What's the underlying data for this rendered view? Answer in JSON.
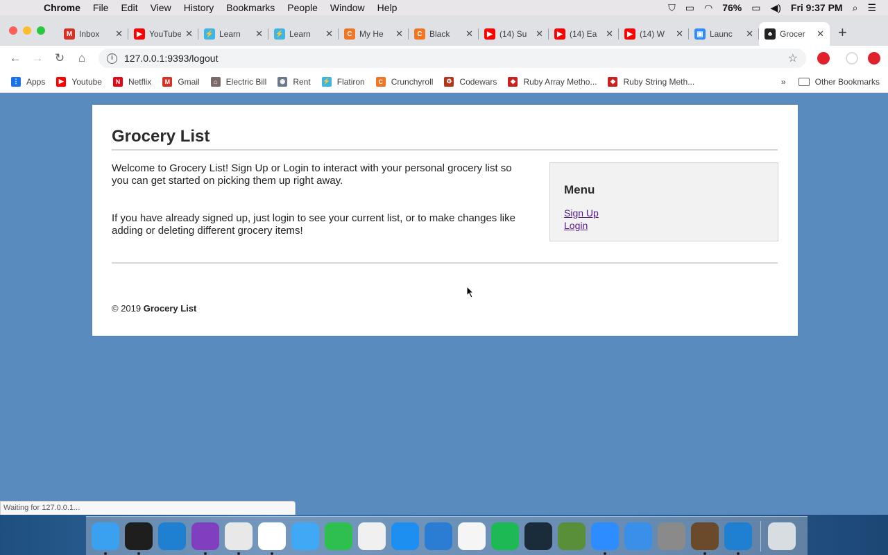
{
  "menubar": {
    "app": "Chrome",
    "items": [
      "File",
      "Edit",
      "View",
      "History",
      "Bookmarks",
      "People",
      "Window",
      "Help"
    ],
    "battery": "76%",
    "clock": "Fri 9:37 PM"
  },
  "tabs": [
    {
      "title": "Inbox",
      "color": "#d93025",
      "glyph": "M"
    },
    {
      "title": "YouTube",
      "color": "#ff0000",
      "glyph": "▶"
    },
    {
      "title": "Learn",
      "color": "#3db5e6",
      "glyph": "⚡"
    },
    {
      "title": "Learn",
      "color": "#3db5e6",
      "glyph": "⚡"
    },
    {
      "title": "My He",
      "color": "#f47521",
      "glyph": "C"
    },
    {
      "title": "Black",
      "color": "#f47521",
      "glyph": "C"
    },
    {
      "title": "(14) Su",
      "color": "#ff0000",
      "glyph": "▶"
    },
    {
      "title": "(14) Ea",
      "color": "#ff0000",
      "glyph": "▶"
    },
    {
      "title": "(14) W",
      "color": "#ff0000",
      "glyph": "▶"
    },
    {
      "title": "Launc",
      "color": "#2d8cff",
      "glyph": "▣"
    },
    {
      "title": "Grocer",
      "color": "#222222",
      "glyph": "♣",
      "active": true
    }
  ],
  "address_bar": {
    "url": "127.0.0.1:9393/logout"
  },
  "bookmarks": [
    {
      "label": "Apps",
      "color": "#1a73e8",
      "glyph": "⋮"
    },
    {
      "label": "Youtube",
      "color": "#ff0000",
      "glyph": "▶"
    },
    {
      "label": "Netflix",
      "color": "#e50914",
      "glyph": "N"
    },
    {
      "label": "Gmail",
      "color": "#d93025",
      "glyph": "M"
    },
    {
      "label": "Electric Bill",
      "color": "#7a6a6a",
      "glyph": "⌂"
    },
    {
      "label": "Rent",
      "color": "#6b7a8a",
      "glyph": "◉"
    },
    {
      "label": "Flatiron",
      "color": "#3db5e6",
      "glyph": "⚡"
    },
    {
      "label": "Crunchyroll",
      "color": "#f47521",
      "glyph": "C"
    },
    {
      "label": "Codewars",
      "color": "#b1361e",
      "glyph": "⚙"
    },
    {
      "label": "Ruby Array Metho...",
      "color": "#cc1f1f",
      "glyph": "◆"
    },
    {
      "label": "Ruby String Meth...",
      "color": "#cc1f1f",
      "glyph": "◆"
    }
  ],
  "bookmarks_overflow": "»",
  "other_bookmarks": "Other Bookmarks",
  "page": {
    "site_title": "Grocery List",
    "intro_1": "Welcome to Grocery List! Sign Up or Login to interact with your personal grocery list so you can get started on picking them up right away.",
    "intro_2": "If you have already signed up, just login to see your current list, or to make changes like adding or deleting different grocery items!",
    "menu": {
      "heading": "Menu",
      "signup": "Sign Up",
      "login": "Login"
    },
    "footer_prefix": "© 2019",
    "footer_brand": "Grocery List"
  },
  "status_bar": "Waiting for 127.0.0.1...",
  "dock": [
    {
      "name": "finder",
      "color": "#3aa0f0",
      "run": true
    },
    {
      "name": "terminal",
      "color": "#1e1e1e",
      "run": true
    },
    {
      "name": "vscode",
      "color": "#1f7fd1",
      "run": false
    },
    {
      "name": "github-desktop",
      "color": "#7f3fbf",
      "run": true
    },
    {
      "name": "chrome",
      "color": "#e8e8e8",
      "run": true
    },
    {
      "name": "slack",
      "color": "#ffffff",
      "run": true
    },
    {
      "name": "messages",
      "color": "#3fa9f5",
      "run": false
    },
    {
      "name": "facetime",
      "color": "#2fbf4f",
      "run": false
    },
    {
      "name": "itunes",
      "color": "#f0f0f0",
      "run": false
    },
    {
      "name": "app-store",
      "color": "#1d8ff0",
      "run": false
    },
    {
      "name": "word",
      "color": "#2b7cd3",
      "run": false
    },
    {
      "name": "photos",
      "color": "#f5f5f5",
      "run": false
    },
    {
      "name": "spotify",
      "color": "#1db954",
      "run": false
    },
    {
      "name": "league-of-legends",
      "color": "#1a2b3a",
      "run": false
    },
    {
      "name": "minecraft",
      "color": "#5a8f3a",
      "run": false
    },
    {
      "name": "zoom",
      "color": "#2d8cff",
      "run": true
    },
    {
      "name": "safari",
      "color": "#3a8fe8",
      "run": false
    },
    {
      "name": "system-preferences",
      "color": "#8a8a8a",
      "run": false
    },
    {
      "name": "coffee-app",
      "color": "#6b4a2b",
      "run": true
    },
    {
      "name": "vscode-alt",
      "color": "#1f7fd1",
      "run": true
    },
    {
      "name": "trash",
      "color": "#d8dde2",
      "run": false
    }
  ]
}
